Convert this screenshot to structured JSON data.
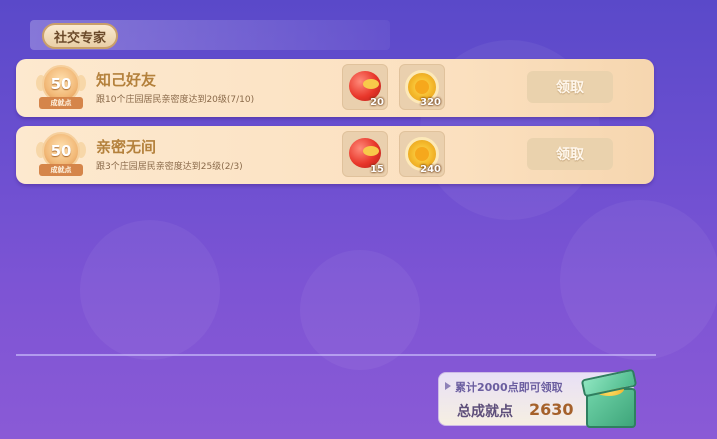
{
  "section": {
    "tab_label": "社交专家"
  },
  "achievements": [
    {
      "medal_points": "50",
      "medal_caption": "成就点",
      "title": "知己好友",
      "description": "跟10个庄园居民亲密度达到20级(7/10)",
      "rewards": [
        {
          "icon": "red-fruit-icon",
          "count": "20"
        },
        {
          "icon": "gold-coin-icon",
          "count": "320"
        }
      ],
      "claim_label": "领取"
    },
    {
      "medal_points": "50",
      "medal_caption": "成就点",
      "title": "亲密无间",
      "description": "跟3个庄园居民亲密度达到25级(2/3)",
      "rewards": [
        {
          "icon": "red-fruit-icon",
          "count": "15"
        },
        {
          "icon": "gold-coin-icon",
          "count": "240"
        }
      ],
      "claim_label": "领取"
    }
  ],
  "total": {
    "hint": "累计2000点即可领取",
    "label": "总成就点",
    "value": "2630"
  },
  "colors": {
    "background": "#6b4fd0",
    "card": "#fde9cf",
    "title": "#b4813c",
    "claim_button": "#ead2ad"
  }
}
